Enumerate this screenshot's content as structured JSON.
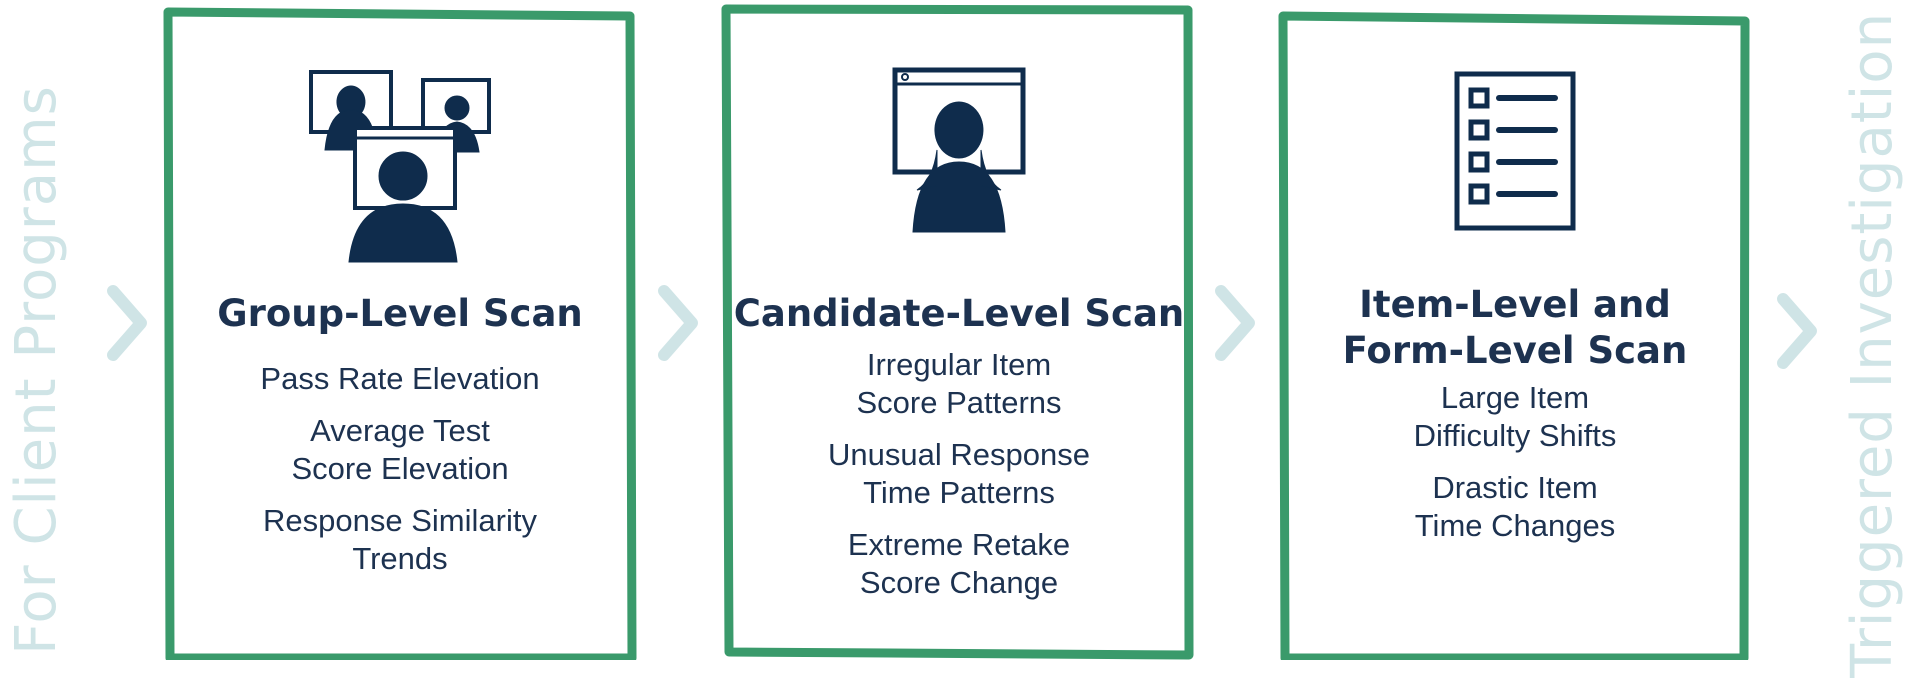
{
  "flow": {
    "start_label": "For Client Programs",
    "end_label": "Triggered Investigation"
  },
  "colors": {
    "frame": "#3a9a6b",
    "text": "#1d3250",
    "faded": "#cfe4e6",
    "icon": "#0f2c4c"
  },
  "stages": [
    {
      "icon": "group-video-icon",
      "title": "Group-Level Scan",
      "items": [
        "Pass Rate Elevation",
        "Average Test\nScore Elevation",
        "Response Similarity\nTrends"
      ]
    },
    {
      "icon": "candidate-video-icon",
      "title": "Candidate-Level Scan",
      "items": [
        "Irregular Item\nScore Patterns",
        "Unusual Response\nTime Patterns",
        "Extreme Retake\nScore Change"
      ]
    },
    {
      "icon": "checklist-icon",
      "title": "Item-Level and\nForm-Level Scan",
      "items": [
        "Large Item\nDifficulty Shifts",
        "Drastic Item\nTime Changes"
      ]
    }
  ]
}
